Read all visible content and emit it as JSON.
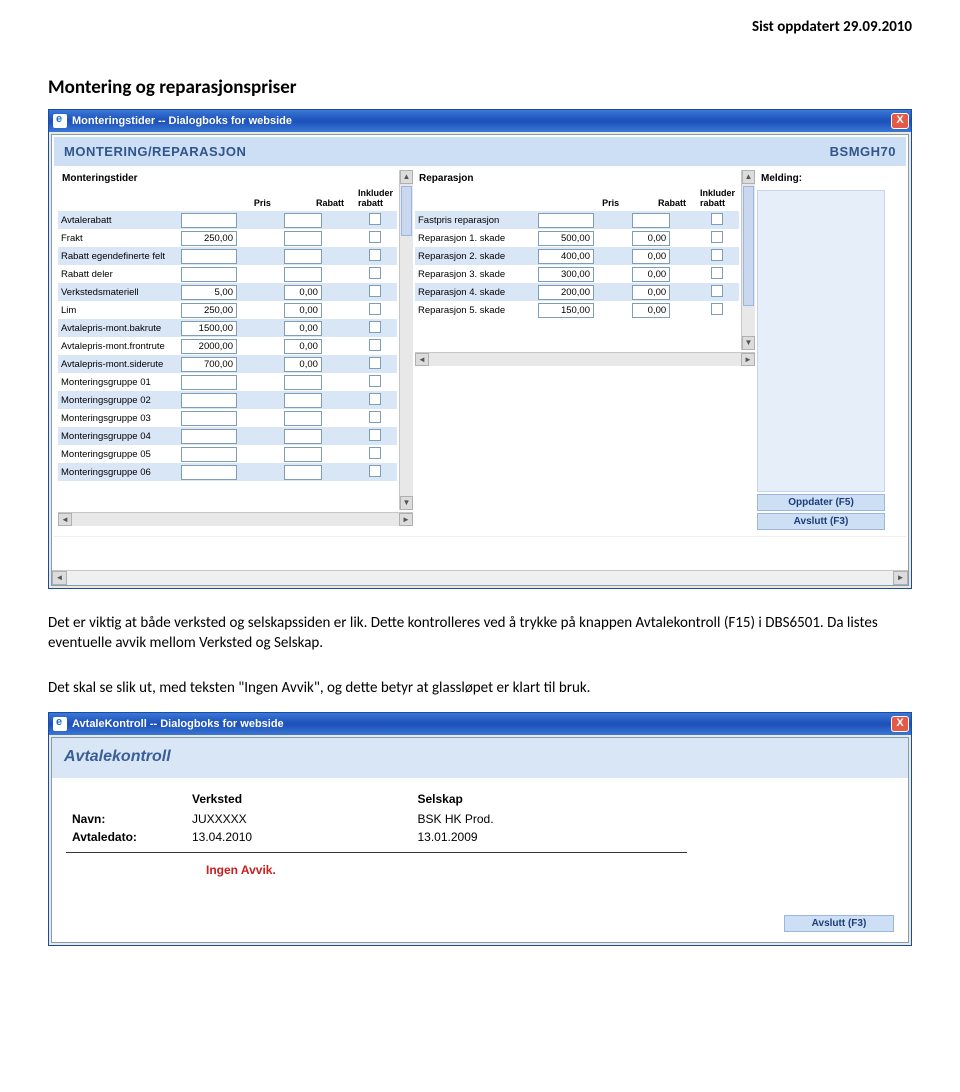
{
  "page_header": "Sist oppdatert 29.09.2010",
  "section_title": "Montering og reparasjonspriser",
  "body_p1": "Det er viktig at både verksted og selskapssiden er lik. Dette kontrolleres ved å trykke på knappen Avtalekontroll (F15) i DBS6501. Da listes eventuelle avvik mellom Verksted og Selskap.",
  "body_p2": "Det skal se slik ut, med teksten \"Ingen Avvik\", og dette betyr at glassløpet er klart til bruk.",
  "dialog1": {
    "title": "Monteringstider -- Dialogboks for webside",
    "app_title": "MONTERING/REPARASJON",
    "app_code": "BSMGH70",
    "headers": {
      "pris": "Pris",
      "rabatt": "Rabatt",
      "inkluder": "Inkluder rabatt"
    },
    "montering": {
      "title": "Monteringstider",
      "rows": [
        {
          "label": "Avtalerabatt",
          "pris": "",
          "rabatt": "",
          "chk": false
        },
        {
          "label": "Frakt",
          "pris": "250,00",
          "rabatt": "",
          "chk": false
        },
        {
          "label": "Rabatt egendefinerte felt",
          "pris": "",
          "rabatt": "",
          "chk": false
        },
        {
          "label": "Rabatt deler",
          "pris": "",
          "rabatt": "",
          "chk": false
        },
        {
          "label": "Verkstedsmateriell",
          "pris": "5,00",
          "rabatt": "0,00",
          "chk": false
        },
        {
          "label": "Lim",
          "pris": "250,00",
          "rabatt": "0,00",
          "chk": false
        },
        {
          "label": "Avtalepris-mont.bakrute",
          "pris": "1500,00",
          "rabatt": "0,00",
          "chk": false
        },
        {
          "label": "Avtalepris-mont.frontrute",
          "pris": "2000,00",
          "rabatt": "0,00",
          "chk": false
        },
        {
          "label": "Avtalepris-mont.siderute",
          "pris": "700,00",
          "rabatt": "0,00",
          "chk": false
        },
        {
          "label": "Monteringsgruppe 01",
          "pris": "",
          "rabatt": "",
          "chk": false
        },
        {
          "label": "Monteringsgruppe 02",
          "pris": "",
          "rabatt": "",
          "chk": false
        },
        {
          "label": "Monteringsgruppe 03",
          "pris": "",
          "rabatt": "",
          "chk": false
        },
        {
          "label": "Monteringsgruppe 04",
          "pris": "",
          "rabatt": "",
          "chk": false
        },
        {
          "label": "Monteringsgruppe 05",
          "pris": "",
          "rabatt": "",
          "chk": false
        },
        {
          "label": "Monteringsgruppe 06",
          "pris": "",
          "rabatt": "",
          "chk": false
        }
      ]
    },
    "reparasjon": {
      "title": "Reparasjon",
      "rows": [
        {
          "label": "Fastpris reparasjon",
          "pris": "",
          "rabatt": "",
          "chk": false
        },
        {
          "label": "Reparasjon 1. skade",
          "pris": "500,00",
          "rabatt": "0,00",
          "chk": false
        },
        {
          "label": "Reparasjon 2. skade",
          "pris": "400,00",
          "rabatt": "0,00",
          "chk": false
        },
        {
          "label": "Reparasjon 3. skade",
          "pris": "300,00",
          "rabatt": "0,00",
          "chk": false
        },
        {
          "label": "Reparasjon 4. skade",
          "pris": "200,00",
          "rabatt": "0,00",
          "chk": false
        },
        {
          "label": "Reparasjon 5. skade",
          "pris": "150,00",
          "rabatt": "0,00",
          "chk": false
        }
      ]
    },
    "melding_label": "Melding:",
    "btn_update": "Oppdater (F5)",
    "btn_exit": "Avslutt (F3)"
  },
  "dialog2": {
    "title": "AvtaleKontroll -- Dialogboks for webside",
    "app_title": "Avtalekontroll",
    "col_verksted": "Verksted",
    "col_selskap": "Selskap",
    "row_navn": "Navn:",
    "row_dato": "Avtaledato:",
    "val_verksted": "JUXXXXX",
    "val_selskap": "BSK HK Prod.",
    "val_dato_v": "13.04.2010",
    "val_dato_s": "13.01.2009",
    "avvik_text": "Ingen Avvik.",
    "btn_exit": "Avslutt (F3)"
  }
}
